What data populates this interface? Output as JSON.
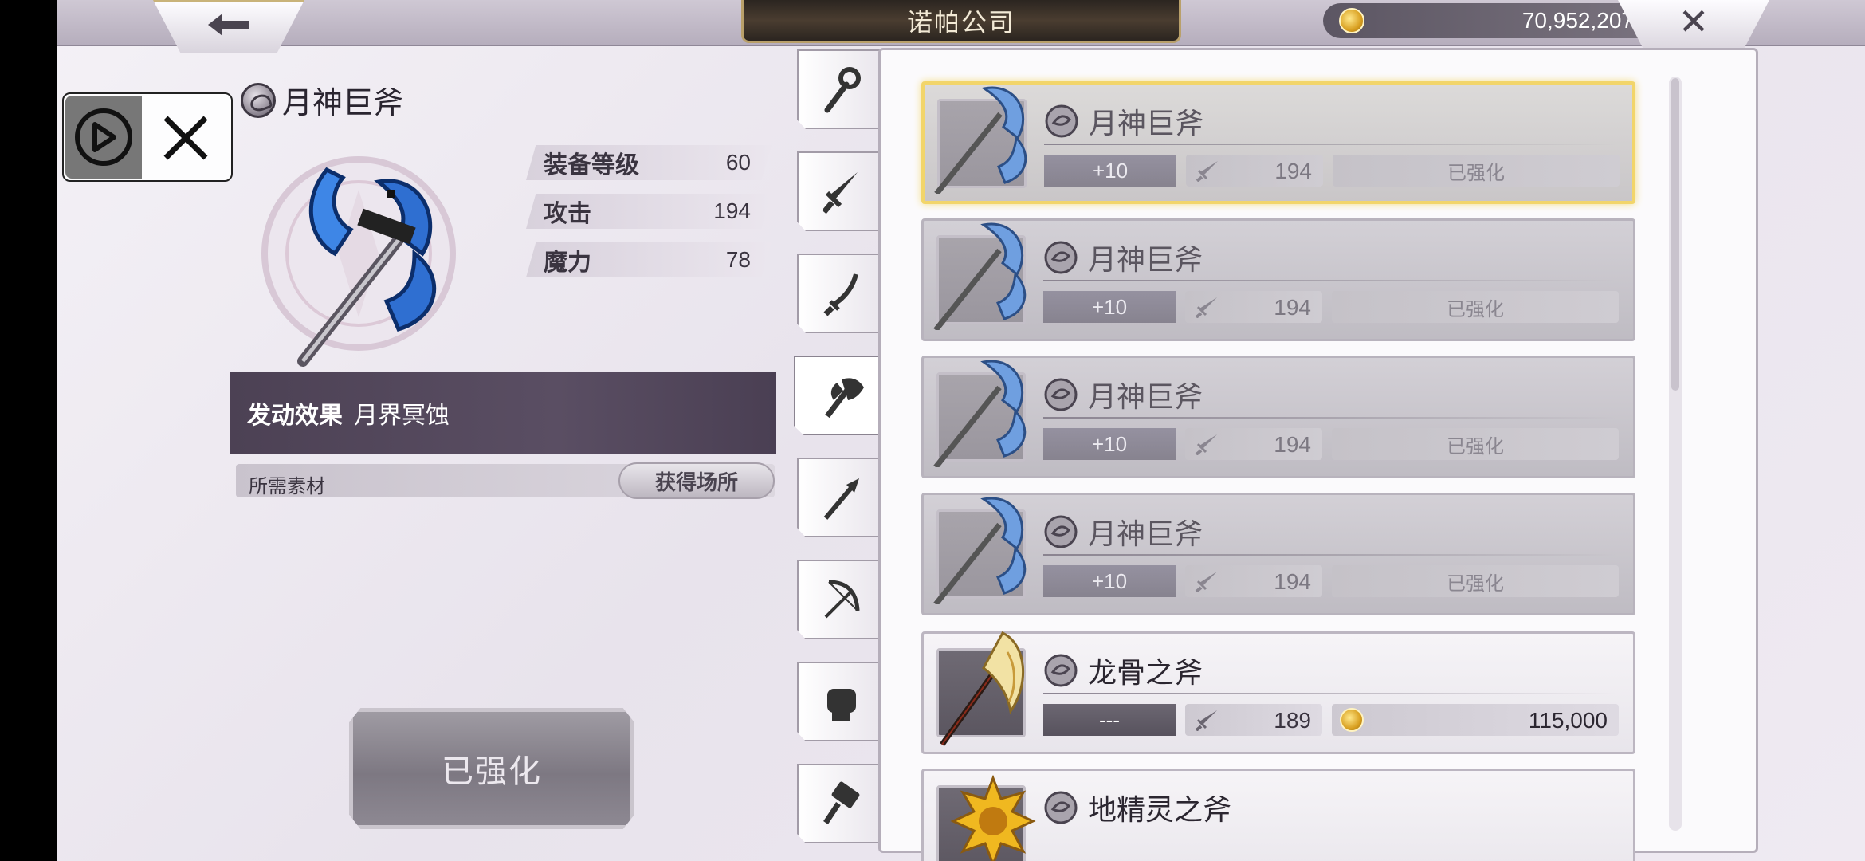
{
  "header": {
    "title": "诺帕公司",
    "currency": "70,952,207",
    "back_icon": "back-arrow-icon",
    "close_icon": "close-icon"
  },
  "overlay": {
    "play_icon": "play-icon",
    "close_icon": "close-icon"
  },
  "detail": {
    "name": "月神巨斧",
    "stats": [
      {
        "label": "装备等级",
        "value": "60"
      },
      {
        "label": "攻击",
        "value": "194"
      },
      {
        "label": "魔力",
        "value": "78"
      }
    ],
    "effect_label": "发动效果",
    "effect_value": "月界冥蚀",
    "material_label": "所需素材",
    "obtain_label": "获得场所",
    "enhance_button": "已强化"
  },
  "tabs": [
    {
      "icon": "staff-icon"
    },
    {
      "icon": "sword-icon"
    },
    {
      "icon": "katana-icon"
    },
    {
      "icon": "axe-icon",
      "active": true
    },
    {
      "icon": "spear-icon"
    },
    {
      "icon": "bow-icon"
    },
    {
      "icon": "fist-icon"
    },
    {
      "icon": "hammer-icon"
    }
  ],
  "items": [
    {
      "name": "月神巨斧",
      "level": "+10",
      "attack": "194",
      "status": "已强化"
    },
    {
      "name": "月神巨斧",
      "level": "+10",
      "attack": "194",
      "status": "已强化"
    },
    {
      "name": "月神巨斧",
      "level": "+10",
      "attack": "194",
      "status": "已强化"
    },
    {
      "name": "月神巨斧",
      "level": "+10",
      "attack": "194",
      "status": "已强化"
    },
    {
      "name": "龙骨之斧",
      "level": "---",
      "attack": "189",
      "price": "115,000"
    },
    {
      "name": "地精灵之斧"
    }
  ],
  "colors": {
    "accent_gold": "#f2d56a",
    "effect_bar": "#4c4154",
    "title_plate": "#2b2520"
  }
}
